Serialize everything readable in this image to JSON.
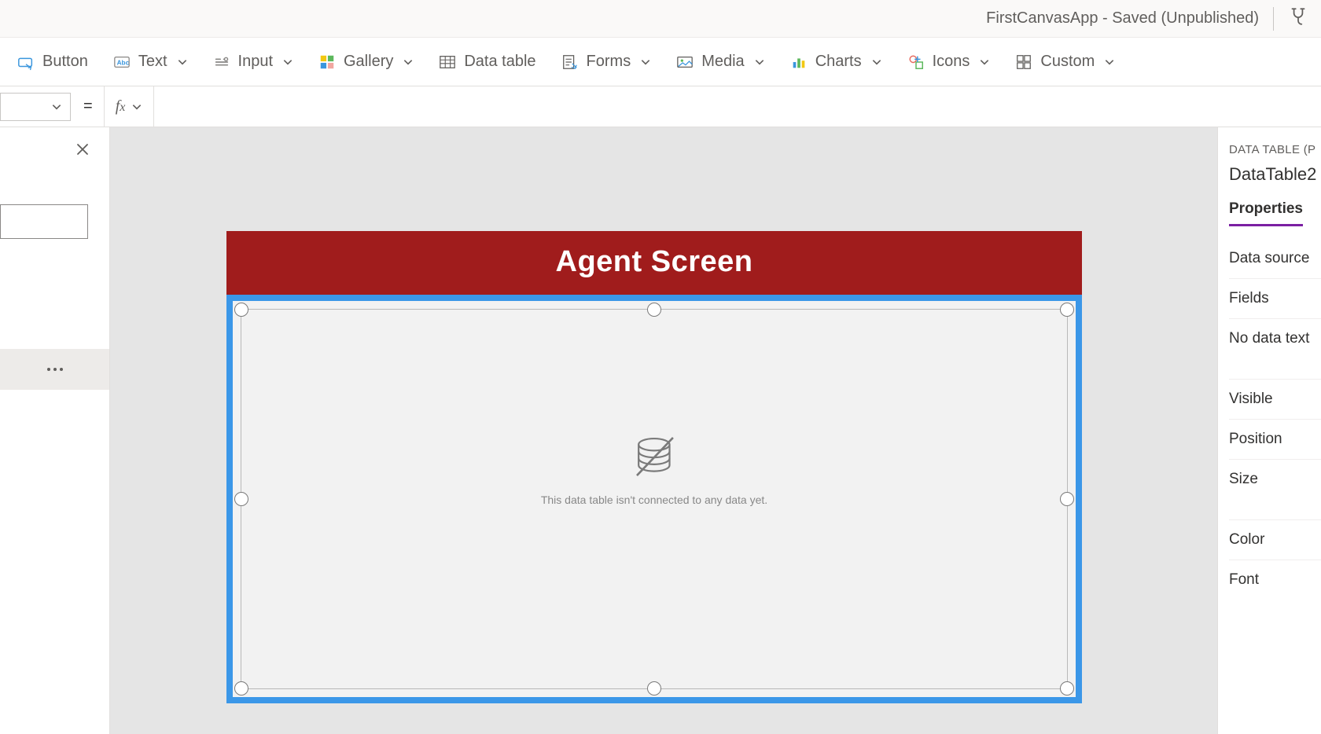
{
  "titlebar": {
    "app_title": "FirstCanvasApp - Saved (Unpublished)"
  },
  "ribbon": {
    "button": "Button",
    "text": "Text",
    "input": "Input",
    "gallery": "Gallery",
    "data_table": "Data table",
    "forms": "Forms",
    "media": "Media",
    "charts": "Charts",
    "icons": "Icons",
    "custom": "Custom"
  },
  "formula": {
    "equals": "=",
    "fx": "fx",
    "value": ""
  },
  "canvas": {
    "screen_title": "Agent Screen",
    "empty_message": "This data table isn't connected to any data yet."
  },
  "properties": {
    "header": "DATA TABLE (P",
    "object_name": "DataTable2",
    "tab": "Properties",
    "rows": {
      "data_source": "Data source",
      "fields": "Fields",
      "no_data_text": "No data text",
      "visible": "Visible",
      "position": "Position",
      "size": "Size",
      "color": "Color",
      "font": "Font"
    }
  }
}
